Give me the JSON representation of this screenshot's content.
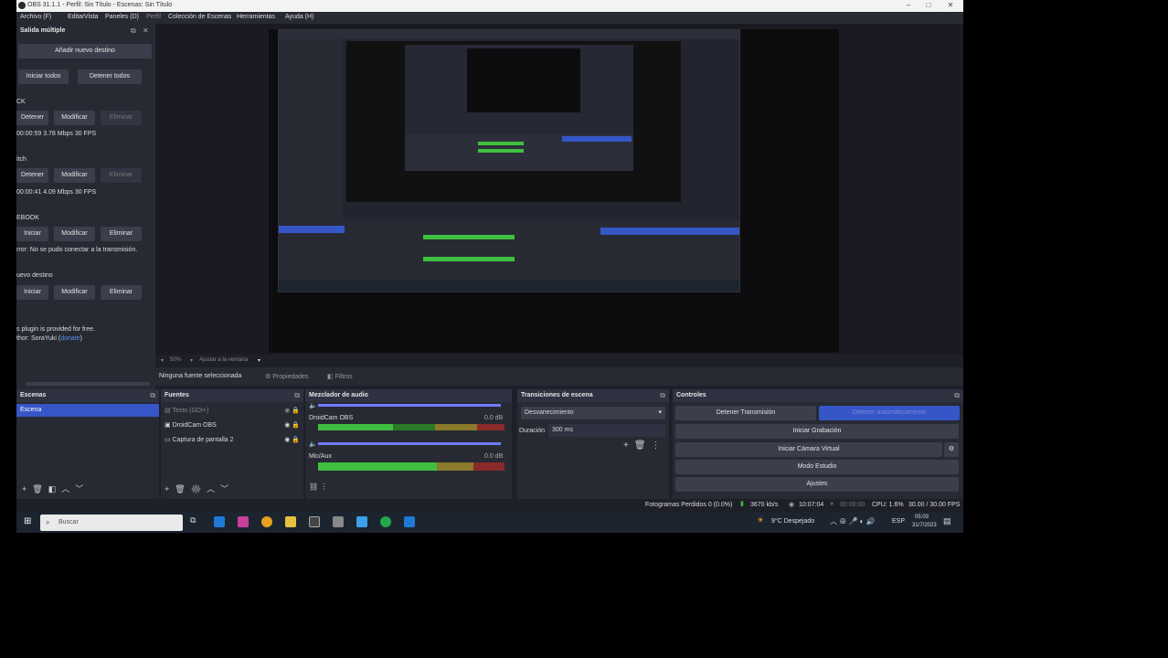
{
  "window": {
    "title": "OBS 31.1.1 - Perfil: Sin Título - Escenas: Sin Título"
  },
  "menu": [
    "Archivo (F)",
    "Editar",
    "Vista",
    "Paneles (D)",
    "Perfil",
    "Colección de Escenas",
    "Herramientas",
    "Ayuda (H)"
  ],
  "multiple_output": {
    "title": "Salida múltiple",
    "add_target": "Añadir nuevo destino",
    "start_all": "Iniciar todos",
    "stop_all": "Detener todos",
    "targets": [
      {
        "name": "CK",
        "btn1": "Detener",
        "btn2": "Modificar",
        "btn3": "Eliminar",
        "status": "00:00:59  3.78 Mbps  30 FPS"
      },
      {
        "name": "itch",
        "btn1": "Detener",
        "btn2": "Modificar",
        "btn3": "Eliminar",
        "status": "00:00:41  4.09 Mbps  30 FPS"
      },
      {
        "name": "EBOOK",
        "btn1": "Iniciar",
        "btn2": "Modificar",
        "btn3": "Eliminar",
        "status": "rror: No se pudo conectar a la transmisión."
      },
      {
        "name": "uevo destino",
        "btn1": "Iniciar",
        "btn2": "Modificar",
        "btn3": "Eliminar",
        "status": ""
      }
    ],
    "footer1": "s plugin is provided for free.",
    "footer2": "thor: SoraYuki (",
    "footer_link": "donate",
    "footer_end": ")"
  },
  "below_preview": {
    "zoom": "50%",
    "fit": "Ajustar a la ventana"
  },
  "source_toolbar": {
    "none_selected": "Ninguna fuente seleccionada",
    "properties": "Propiedades",
    "filters": "Filtros"
  },
  "scenes": {
    "title": "Escenas",
    "items": [
      "Escena"
    ]
  },
  "sources": {
    "title": "Fuentes",
    "items": [
      "Texto (GDI+)",
      "DroidCam OBS",
      "Captura de pantalla 2"
    ]
  },
  "mixer": {
    "title": "Mezclador de audio",
    "channels": [
      {
        "name": "DroidCam OBS",
        "db": "0.0 dB"
      },
      {
        "name": "Mic/Aux",
        "db": "0.0 dB"
      }
    ],
    "scale": [
      "-60",
      "-55",
      "-50",
      "-45",
      "-40",
      "-35",
      "-30",
      "-25",
      "-20",
      "-15",
      "-10",
      "-5",
      "0"
    ]
  },
  "transitions": {
    "title": "Transiciones de escena",
    "selected": "Desvanecimiento",
    "duration_label": "Duración",
    "duration_value": "300 ms"
  },
  "controls": {
    "title": "Controles",
    "stop_stream": "Detener Transmisión",
    "auto_stop": "Detener automáticamente",
    "start_recording": "Iniciar Grabación",
    "start_virtual_cam": "Iniciar Cámara Virtual",
    "studio_mode": "Modo Estudio",
    "settings": "Ajustes"
  },
  "status": {
    "dropped": "Fotogramas Perdidos 0 (0.0%)",
    "bitrate": "3670 kb/s",
    "stream_time": "10:07:04",
    "rec_time": "00:00:00",
    "cpu": "CPU: 1.6%",
    "fps": "30.00 / 30.00 FPS"
  },
  "taskbar": {
    "search": "Buscar",
    "weather": "9°C  Despejado",
    "lang": "ESP",
    "time": "05:03",
    "date": "31/7/2023"
  },
  "colors": {
    "accent": "#3656c8",
    "panel": "#272a33",
    "bg": "#1e1f28"
  }
}
